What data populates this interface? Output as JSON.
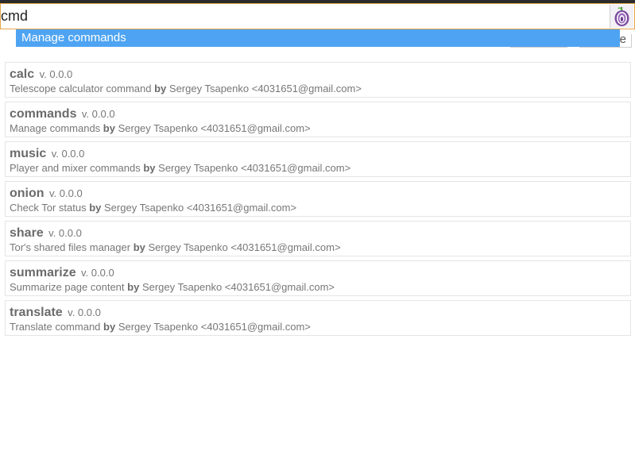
{
  "command_bar": {
    "value": "cmd",
    "icon": "tor-onion-icon"
  },
  "suggestion": {
    "label": "Manage commands"
  },
  "commands": [
    {
      "name": "calc",
      "version": "v. 0.0.0",
      "description": "Telescope calculator command",
      "by": "by",
      "author": "Sergey Tsapenko <4031651@gmail.com>"
    },
    {
      "name": "commands",
      "version": "v. 0.0.0",
      "description": "Manage commands",
      "by": "by",
      "author": "Sergey Tsapenko <4031651@gmail.com>"
    },
    {
      "name": "music",
      "version": "v. 0.0.0",
      "description": "Player and mixer commands",
      "by": "by",
      "author": "Sergey Tsapenko <4031651@gmail.com>"
    },
    {
      "name": "onion",
      "version": "v. 0.0.0",
      "description": "Check Tor status",
      "by": "by",
      "author": "Sergey Tsapenko <4031651@gmail.com>"
    },
    {
      "name": "share",
      "version": "v. 0.0.0",
      "description": "Tor's shared files manager",
      "by": "by",
      "author": "Sergey Tsapenko <4031651@gmail.com>"
    },
    {
      "name": "summarize",
      "version": "v. 0.0.0",
      "description": "Summarize page content",
      "by": "by",
      "author": "Sergey Tsapenko <4031651@gmail.com>"
    },
    {
      "name": "translate",
      "version": "v. 0.0.0",
      "description": "Translate command",
      "by": "by",
      "author": "Sergey Tsapenko <4031651@gmail.com>"
    }
  ],
  "partial_button": {
    "label": "e"
  }
}
